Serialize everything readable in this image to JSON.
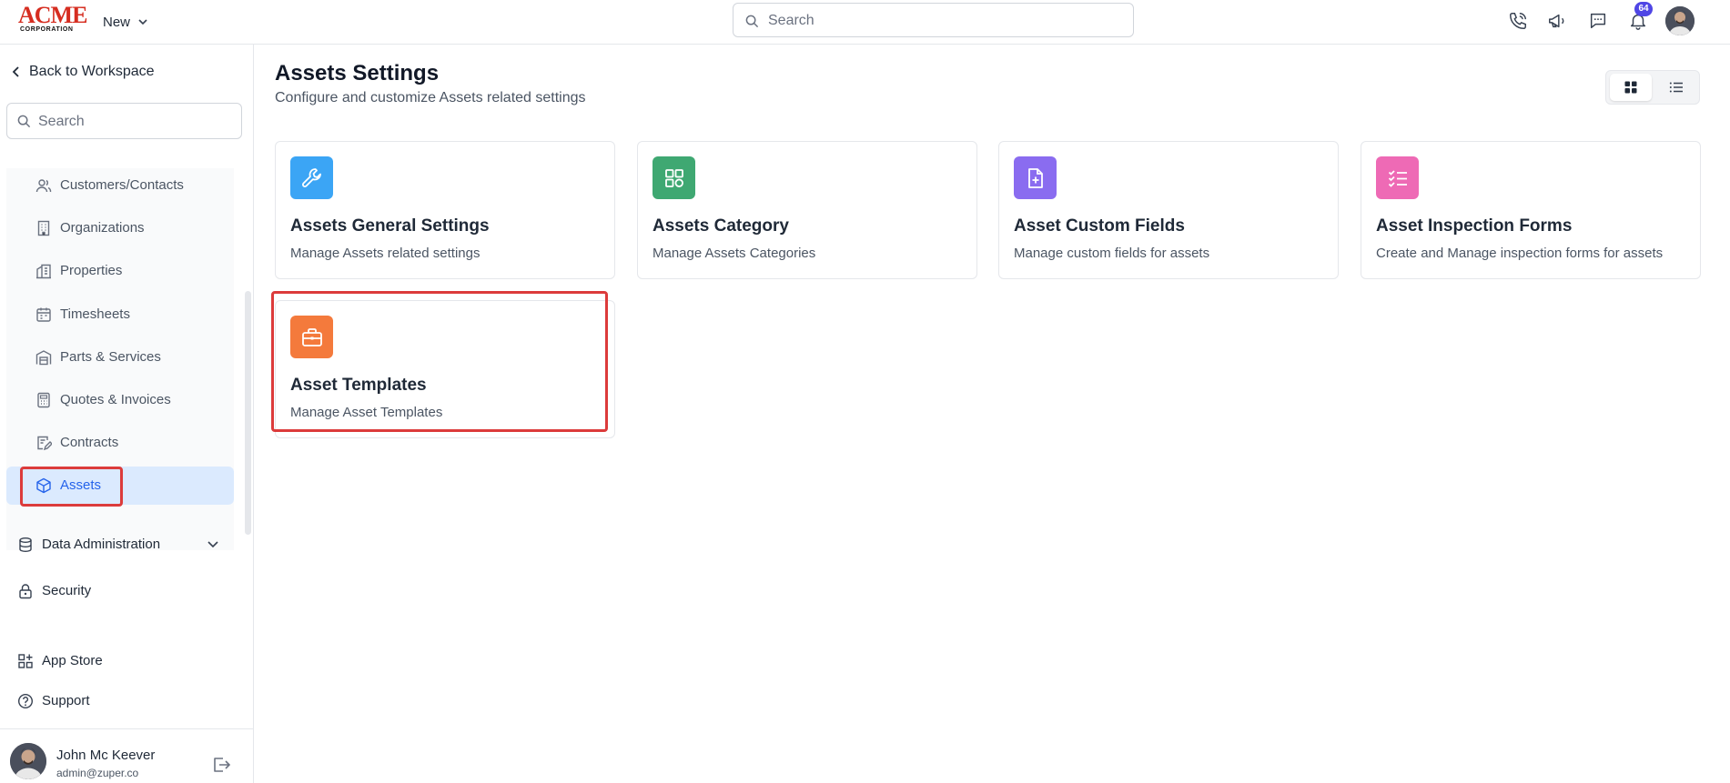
{
  "header": {
    "logo_text": "ACME",
    "logo_subtext": "CORPORATION",
    "new_label": "New",
    "search_placeholder": "Search",
    "notification_count": "64",
    "icons": [
      "phone-icon",
      "megaphone-icon",
      "chat-icon",
      "bell-icon"
    ]
  },
  "sidebar": {
    "back_label": "Back to Workspace",
    "search_placeholder": "Search",
    "settings_items": [
      {
        "label": "Customers/Contacts",
        "icon": "users-icon"
      },
      {
        "label": "Organizations",
        "icon": "building-icon"
      },
      {
        "label": "Properties",
        "icon": "property-icon"
      },
      {
        "label": "Timesheets",
        "icon": "calendar-icon"
      },
      {
        "label": "Parts & Services",
        "icon": "warehouse-icon"
      },
      {
        "label": "Quotes & Invoices",
        "icon": "calculator-icon"
      },
      {
        "label": "Contracts",
        "icon": "contract-icon"
      },
      {
        "label": "Assets",
        "icon": "cube-icon",
        "active": true
      }
    ],
    "sections": [
      {
        "label": "Data Administration",
        "icon": "database-icon",
        "expandable": true
      },
      {
        "label": "Security",
        "icon": "lock-icon"
      },
      {
        "label": "App Store",
        "icon": "app-store-icon"
      },
      {
        "label": "Support",
        "icon": "help-icon"
      }
    ],
    "user": {
      "name": "John Mc Keever",
      "email": "admin@zuper.co"
    }
  },
  "main": {
    "title": "Assets Settings",
    "subtitle": "Configure and customize Assets related settings",
    "view_modes": [
      "grid",
      "list"
    ],
    "active_view": "grid",
    "cards": [
      {
        "title": "Assets General Settings",
        "description": "Manage Assets related settings",
        "icon": "wrench-icon",
        "color": "#3ba5f5"
      },
      {
        "title": "Assets Category",
        "description": "Manage Assets Categories",
        "icon": "category-icon",
        "color": "#3fa872"
      },
      {
        "title": "Asset Custom Fields",
        "description": "Manage custom fields for assets",
        "icon": "file-plus-icon",
        "color": "#8a6cf0"
      },
      {
        "title": "Asset Inspection Forms",
        "description": "Create and Manage inspection forms for assets",
        "icon": "checklist-icon",
        "color": "#ee6ab5"
      },
      {
        "title": "Asset Templates",
        "description": "Manage Asset Templates",
        "icon": "briefcase-icon",
        "color": "#f47a3c",
        "highlighted": true
      }
    ]
  },
  "colors": {
    "accent": "#2563eb",
    "highlight": "#dc3b3b",
    "active_bg": "#dbeafe"
  }
}
